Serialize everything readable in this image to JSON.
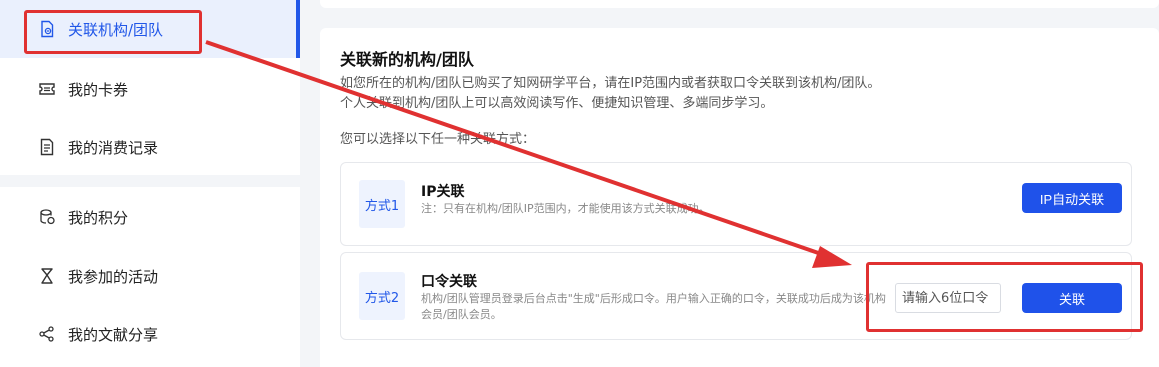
{
  "sidebar": {
    "items": [
      {
        "label": "关联机构/团队",
        "icon": "linked-document-icon",
        "active": true
      },
      {
        "label": "我的卡券",
        "icon": "ticket-icon"
      },
      {
        "label": "我的消费记录",
        "icon": "receipt-icon"
      },
      {
        "label": "我的积分",
        "icon": "coins-icon"
      },
      {
        "label": "我参加的活动",
        "icon": "activity-icon"
      },
      {
        "label": "我的文献分享",
        "icon": "share-icon"
      }
    ]
  },
  "main": {
    "title": "关联新的机构/团队",
    "desc_line1": "如您所在的机构/团队已购买了知网研学平台，请在IP范围内或者获取口令关联到该机构/团队。",
    "desc_line2": "个人关联到机构/团队上可以高效阅读写作、便捷知识管理、多端同步学习。",
    "choose_text": "您可以选择以下任一种关联方式：",
    "methods": [
      {
        "badge": "方式1",
        "title": "IP关联",
        "note": "注：只有在机构/团队IP范围内，才能使用该方式关联成功。",
        "button": "IP自动关联"
      },
      {
        "badge": "方式2",
        "title": "口令关联",
        "note": "机构/团队管理员登录后台点击\"生成\"后形成口令。用户输入正确的口令，关联成功后成为该机构会员/团队会员。",
        "placeholder": "请输入6位口令",
        "button": "关联"
      }
    ]
  },
  "colors": {
    "accent": "#2157e8",
    "annotation": "#e03131"
  }
}
